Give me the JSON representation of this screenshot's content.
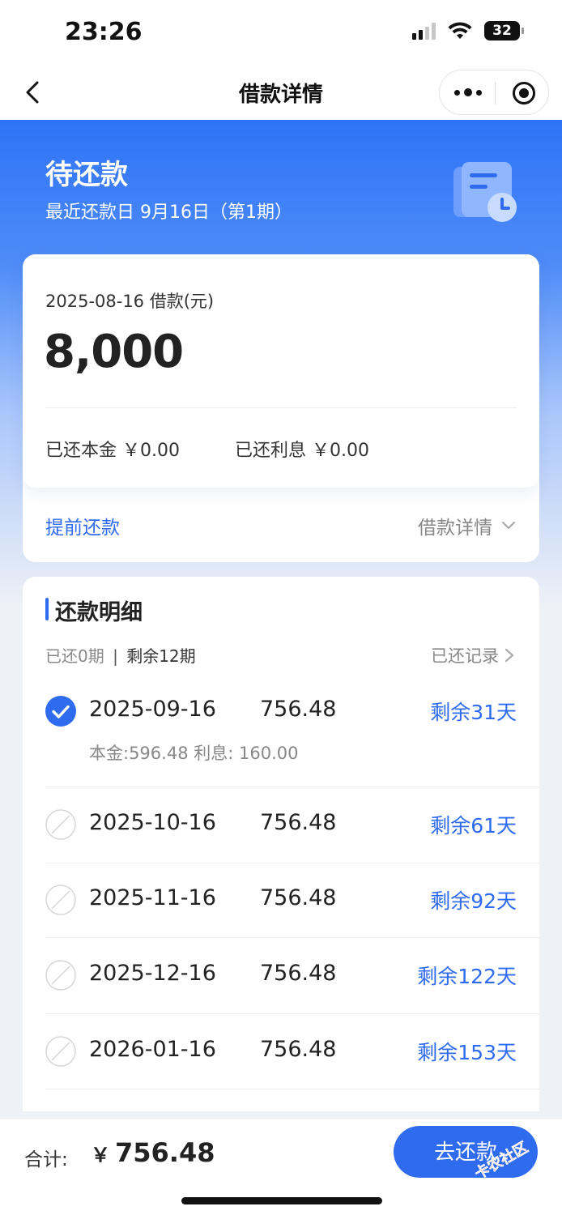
{
  "status_bar": {
    "time": "23:26",
    "battery": "32"
  },
  "nav": {
    "title": "借款详情"
  },
  "hero": {
    "title": "待还款",
    "subtitle": "最近还款日 9月16日（第1期）"
  },
  "loan": {
    "label": "2025-08-16 借款(元)",
    "amount": "8,000",
    "paid_principal": "已还本金 ￥0.00",
    "paid_interest": "已还利息 ￥0.00",
    "prepay": "提前还款",
    "detail_toggle": "借款详情"
  },
  "schedule": {
    "title": "还款明细",
    "paid_periods": "已还0期",
    "separator": "|",
    "remaining_periods": "剩余12期",
    "history": "已还记录",
    "rows": [
      {
        "date": "2025-09-16",
        "amount": "756.48",
        "days": "剩余31天",
        "breakdown": "本金:596.48   利息: 160.00",
        "selected": true
      },
      {
        "date": "2025-10-16",
        "amount": "756.48",
        "days": "剩余61天",
        "selected": false
      },
      {
        "date": "2025-11-16",
        "amount": "756.48",
        "days": "剩余92天",
        "selected": false
      },
      {
        "date": "2025-12-16",
        "amount": "756.48",
        "days": "剩余122天",
        "selected": false
      },
      {
        "date": "2026-01-16",
        "amount": "756.48",
        "days": "剩余153天",
        "selected": false
      }
    ]
  },
  "footer": {
    "total_label": "合计:",
    "currency": "￥",
    "total": "756.48",
    "pay_button": "去还款"
  },
  "watermark": "卡农社区",
  "colors": {
    "accent": "#2f6bef",
    "hero_top": "#2e73f7"
  }
}
